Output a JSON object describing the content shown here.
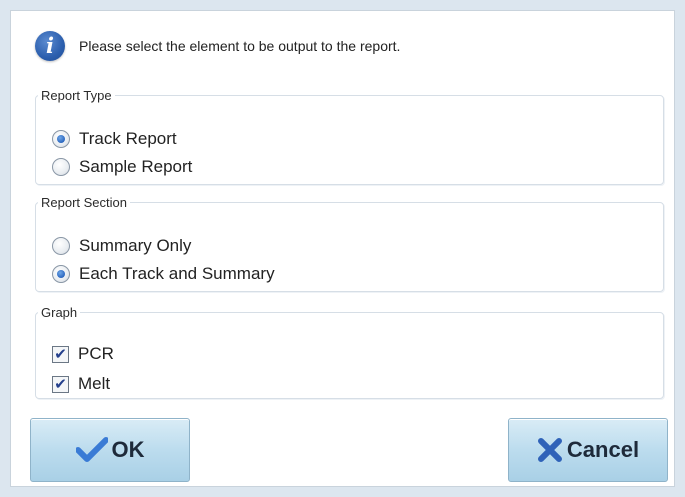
{
  "dialog": {
    "message": "Please select the element to be output to the report."
  },
  "report_type": {
    "legend": "Report Type",
    "options": [
      {
        "label": "Track Report",
        "checked": true
      },
      {
        "label": "Sample Report",
        "checked": false
      }
    ]
  },
  "report_section": {
    "legend": "Report Section",
    "options": [
      {
        "label": "Summary Only",
        "checked": false
      },
      {
        "label": "Each Track and Summary",
        "checked": true
      }
    ]
  },
  "graph": {
    "legend": "Graph",
    "options": [
      {
        "label": "PCR",
        "checked": true
      },
      {
        "label": "Melt",
        "checked": true
      }
    ]
  },
  "buttons": {
    "ok_label": "OK",
    "cancel_label": "Cancel"
  },
  "icons": {
    "info": "info-icon",
    "ok": "checkmark-icon",
    "cancel": "x-icon"
  },
  "colors": {
    "accent_blue": "#2b67c0",
    "button_fill": "#bcdcee",
    "ok_check": "#3a7bd5",
    "cancel_x": "#2f62b8"
  }
}
